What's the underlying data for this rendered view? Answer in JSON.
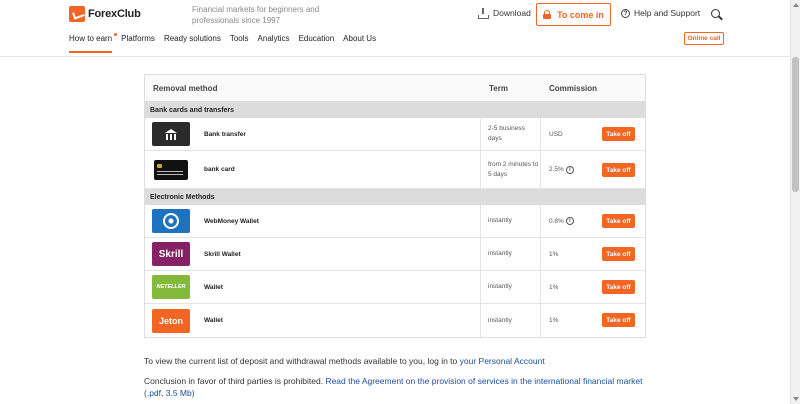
{
  "header": {
    "logo_text": "ForexClub",
    "tagline": "Financial markets for beginners and professionals since 1997",
    "download_label": "Download",
    "come_in_label": "To come in",
    "help_label": "Help and Support",
    "online_call_label": "Online call"
  },
  "nav": {
    "items": [
      {
        "label": "How to earn"
      },
      {
        "label": "Platforms"
      },
      {
        "label": "Ready solutions"
      },
      {
        "label": "Tools"
      },
      {
        "label": "Analytics"
      },
      {
        "label": "Education"
      },
      {
        "label": "About Us"
      }
    ]
  },
  "table": {
    "headers": {
      "method": "Removal method",
      "term": "Term",
      "commission": "Commission"
    },
    "sections": [
      {
        "title": "Bank cards and transfers",
        "rows": [
          {
            "icon": "bank-icon",
            "name": "Bank transfer",
            "term": "2-5 business days",
            "commission": "USD",
            "info": false,
            "action": "Take off"
          },
          {
            "icon": "bank-card-icon",
            "name": "bank card",
            "term": "from 2 minutes to 5 days",
            "commission": "2.5%",
            "info": true,
            "action": "Take off"
          }
        ]
      },
      {
        "title": "Electronic Methods",
        "rows": [
          {
            "icon": "webmoney-icon",
            "name": "WebMoney Wallet",
            "term": "instantly",
            "commission": "0.8%",
            "info": true,
            "action": "Take off"
          },
          {
            "icon": "skrill-logo",
            "logo_text": "Skrill",
            "name": "Skrill Wallet",
            "term": "instantly",
            "commission": "1%",
            "info": false,
            "action": "Take off"
          },
          {
            "icon": "neteller-logo",
            "logo_text": "NETELLER",
            "name": "Wallet",
            "term": "instantly",
            "commission": "1%",
            "info": false,
            "action": "Take off"
          },
          {
            "icon": "jeton-logo",
            "logo_text": "Jeton",
            "name": "Wallet",
            "term": "instantly",
            "commission": "1%",
            "info": false,
            "action": "Take off"
          }
        ]
      }
    ]
  },
  "footer": {
    "p1_text": "To view the current list of deposit and withdrawal methods available to you, log in to ",
    "p1_link": "your Personal Account",
    "p2_text": "Conclusion in favor of third parties is prohibited. ",
    "p2_link": "Read the Agreement on the provision of services in the international financial market (.pdf, 3.5 Mb)"
  },
  "colors": {
    "accent": "#f26522",
    "link": "#1a4f9c",
    "skrill": "#862165",
    "neteller": "#83ba3b",
    "jeton": "#f26522",
    "webmoney": "#1e73be"
  }
}
